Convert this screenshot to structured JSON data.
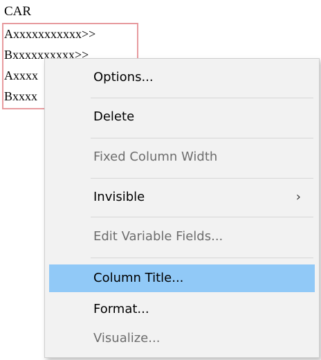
{
  "report": {
    "column_title": "CAR",
    "cells": [
      "Axxxxxxxxxxx>>",
      "Bxxxxxxxxxx>>",
      "Axxxx",
      "Bxxxx"
    ]
  },
  "context_menu": {
    "items": [
      {
        "label": "Options...",
        "enabled": true
      },
      {
        "label": "Delete",
        "enabled": true
      },
      {
        "label": "Fixed Column Width",
        "enabled": false
      },
      {
        "label": "Invisible",
        "enabled": true,
        "submenu_icon": "chevron-right-icon",
        "submenu_glyph": "›"
      },
      {
        "label": "Edit Variable Fields...",
        "enabled": false
      },
      {
        "label": "Column Title...",
        "enabled": true,
        "highlighted": true
      },
      {
        "label": "Format...",
        "enabled": true
      },
      {
        "label": "Visualize...",
        "enabled": false
      }
    ]
  },
  "colors": {
    "selection_border": "#e79a9e",
    "menu_background": "#f2f2f2",
    "highlight": "#91c9f7",
    "disabled_text": "#6d6d6d"
  }
}
